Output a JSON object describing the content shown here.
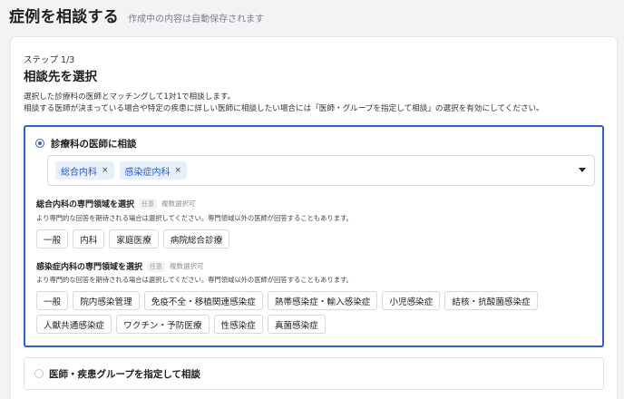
{
  "header": {
    "title": "症例を相談する",
    "autosave_note": "作成中の内容は自動保存されます"
  },
  "step": {
    "label": "ステップ 1/3",
    "title": "相談先を選択",
    "description_line1": "選択した診療科の医師とマッチングして1対1で相談します。",
    "description_line2": "相談する医師が決まっている場合や特定の疾患に詳しい医師に相談したい場合には「医師・グループを指定して相談」の選択を有効にしてください。"
  },
  "options": {
    "specialty": {
      "label": "診療科の医師に相談",
      "selected": true,
      "chips": [
        {
          "label": "総合内科",
          "remove": "×"
        },
        {
          "label": "感染症内科",
          "remove": "×"
        }
      ],
      "groups": [
        {
          "heading": "総合内科の専門領域を選択",
          "optional": "任意",
          "multi": "複数選択可",
          "note": "より専門的な回答を期待される場合は選択してください。専門領域以外の医師が回答することもあります。",
          "tags": [
            "一般",
            "内科",
            "家庭医療",
            "病院総合診療"
          ]
        },
        {
          "heading": "感染症内科の専門領域を選択",
          "optional": "任意",
          "multi": "複数選択可",
          "note": "より専門的な回答を期待される場合は選択してください。専門領域以外の医師が回答することもあります。",
          "tags": [
            "一般",
            "院内感染管理",
            "免疫不全・移植関連感染症",
            "熱帯感染症・輸入感染症",
            "小児感染症",
            "結核・抗酸菌感染症",
            "人獣共通感染症",
            "ワクチン・予防医療",
            "性感染症",
            "真菌感染症"
          ]
        }
      ]
    },
    "group": {
      "label": "医師・疾患グループを指定して相談",
      "selected": false
    }
  },
  "colors": {
    "accent": "#2f5fd1",
    "chip_bg": "#e6effc",
    "chip_text": "#2a5bd7"
  }
}
